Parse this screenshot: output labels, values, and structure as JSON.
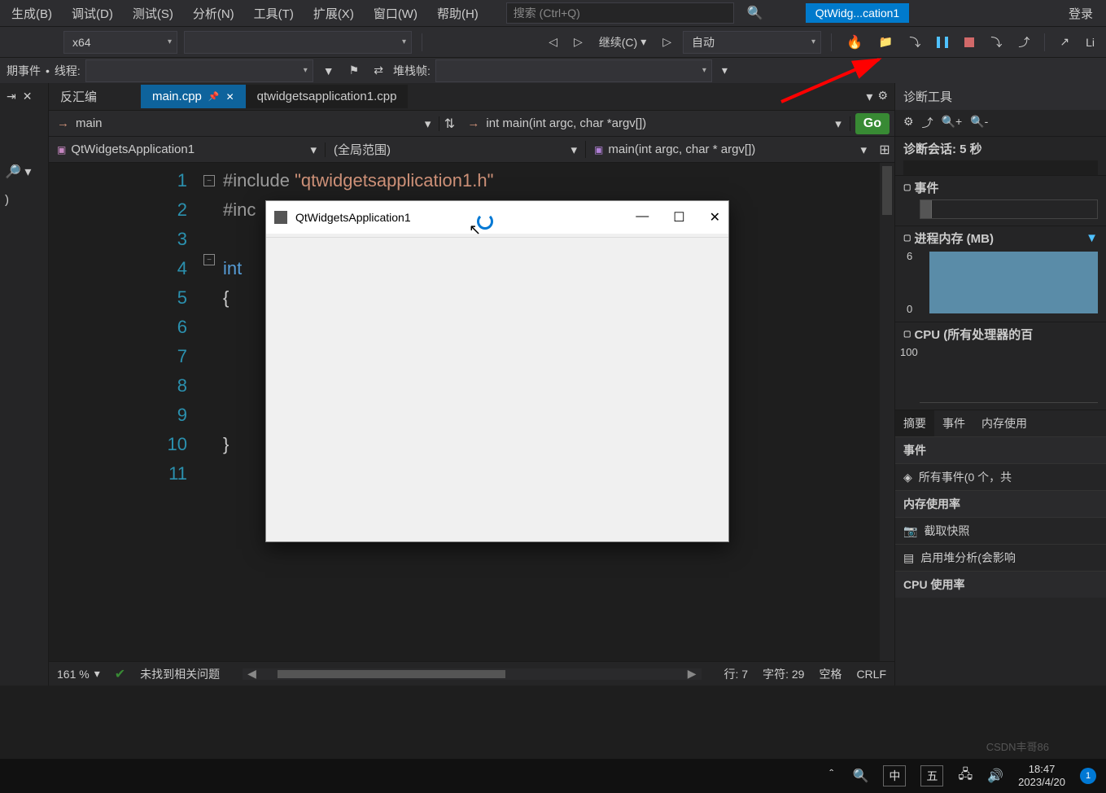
{
  "menubar": {
    "build": "生成(B)",
    "debug": "调试(D)",
    "test": "测试(S)",
    "analyze": "分析(N)",
    "tools": "工具(T)",
    "extensions": "扩展(X)",
    "window": "窗口(W)",
    "help": "帮助(H)",
    "search_placeholder": "搜索 (Ctrl+Q)",
    "project_name": "QtWidg...cation1",
    "login": "登录"
  },
  "toolbar": {
    "platform": "x64",
    "continue": "继续(C)",
    "auto": "自动",
    "li": "Li"
  },
  "debugbar": {
    "issue_event": "期事件",
    "thread_label": "线程:",
    "stack_label": "堆栈帧:"
  },
  "tabs": {
    "disasm": "反汇编",
    "active": "main.cpp",
    "other": "qtwidgetsapplication1.cpp"
  },
  "nav": {
    "scope1": "main",
    "scope2": "int main(int argc, char *argv[])",
    "go": "Go",
    "class_scope": "QtWidgetsApplication1",
    "global_scope": "(全局范围)",
    "func_scope": "main(int argc, char * argv[])"
  },
  "code": {
    "lines": [
      "1",
      "2",
      "3",
      "4",
      "5",
      "6",
      "7",
      "8",
      "9",
      "10",
      "11"
    ],
    "l1_pre": "#include ",
    "l1_str": "\"qtwidgetsapplication1.h\"",
    "l2": "#inc",
    "l4_kw": "int ",
    "l5": "{",
    "l10": "}"
  },
  "status": {
    "zoom": "161 %",
    "issues": "未找到相关问题",
    "line": "行: 7",
    "col": "字符: 29",
    "ins": "空格",
    "eol": "CRLF"
  },
  "diag": {
    "title": "诊断工具",
    "session": "诊断会话: 5 秒",
    "events": "事件",
    "memory": "进程内存 (MB)",
    "mem_max": "6",
    "mem_min": "0",
    "cpu": "CPU (所有处理器的百",
    "cpu_max": "100",
    "tab_summary": "摘要",
    "tab_events": "事件",
    "tab_memory": "内存使用",
    "hdr_events": "事件",
    "all_events": "所有事件(0 个，共",
    "hdr_memory": "内存使用率",
    "snapshot": "截取快照",
    "heap": "启用堆分析(会影响",
    "hdr_cpu": "CPU 使用率"
  },
  "qtwin": {
    "title": "QtWidgetsApplication1"
  },
  "taskbar": {
    "ime1": "中",
    "ime2": "五",
    "time": "18:47",
    "date": "2023/4/20",
    "notif": "1"
  },
  "watermark": "CSDN丰哥86"
}
